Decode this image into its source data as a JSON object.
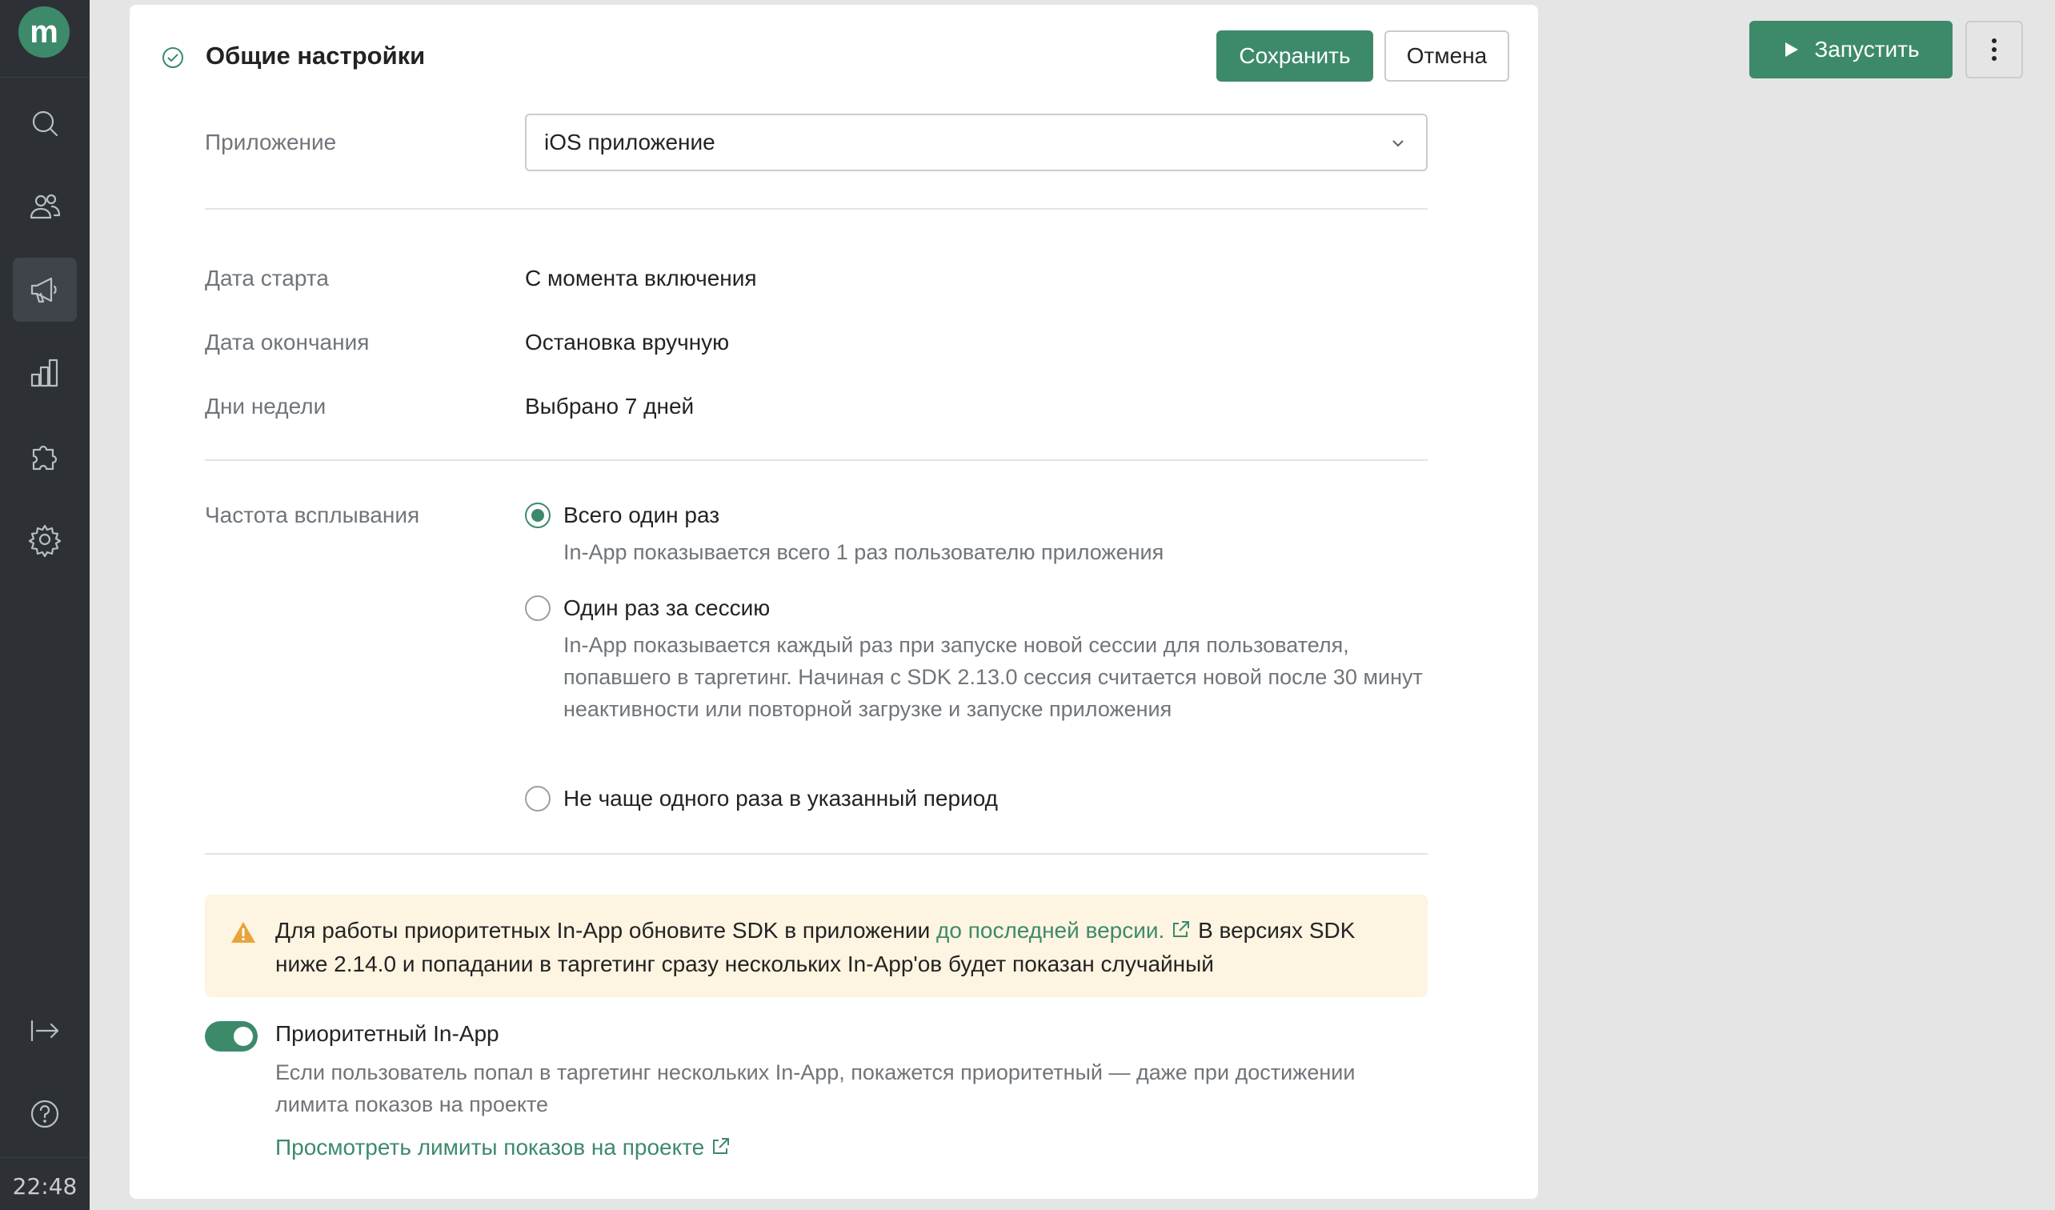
{
  "sidebar": {
    "logo_letter": "m",
    "items": [
      {
        "icon": "search-icon"
      },
      {
        "icon": "users-icon"
      },
      {
        "icon": "megaphone-icon",
        "active": true
      },
      {
        "icon": "chart-icon"
      },
      {
        "icon": "puzzle-icon"
      },
      {
        "icon": "gear-icon"
      }
    ],
    "bottom_items": [
      {
        "icon": "logout-icon"
      },
      {
        "icon": "help-icon"
      }
    ],
    "clock": "22:48"
  },
  "panel": {
    "title": "Общие настройки",
    "save_label": "Сохранить",
    "cancel_label": "Отмена",
    "app_label": "Приложение",
    "app_value": "iOS приложение",
    "start_label": "Дата старта",
    "start_value": "С момента включения",
    "end_label": "Дата окончания",
    "end_value": "Остановка вручную",
    "days_label": "Дни недели",
    "days_value": "Выбрано 7 дней",
    "frequency_label": "Частота всплывания",
    "frequency_options": [
      {
        "title": "Всего один раз",
        "desc": "In-App показывается всего 1 раз пользователю приложения",
        "checked": true
      },
      {
        "title": "Один раз за сессию",
        "desc": "In-App показывается каждый раз при запуске новой сессии для пользователя, попавшего в таргетинг. Начиная с SDK 2.13.0 сессия считается новой после 30 минут неактивности или повторной загрузке и запуске приложения",
        "checked": false
      },
      {
        "title": "Не чаще одного раза в указанный период",
        "desc": "",
        "checked": false
      }
    ],
    "alert": {
      "text_before": "Для работы приоритетных In-App обновите SDK в приложении ",
      "link": "до последней версии.",
      "text_after": " В версиях SDK ниже 2.14.0 и попадании в таргетинг сразу нескольких In-App'ов будет показан случайный"
    },
    "priority": {
      "title": "Приоритетный In-App",
      "enabled": true,
      "desc": "Если пользователь попал в таргетинг нескольких In-App, покажется приоритетный — даже при достижении лимита показов на проекте",
      "link": "Просмотреть лимиты показов на проекте"
    }
  },
  "header": {
    "run_label": "Запустить"
  },
  "colors": {
    "accent": "#3d8a6b",
    "sidebar": "#2d3136",
    "alert_bg": "#fdf4e1",
    "warning": "#e8a33a"
  }
}
